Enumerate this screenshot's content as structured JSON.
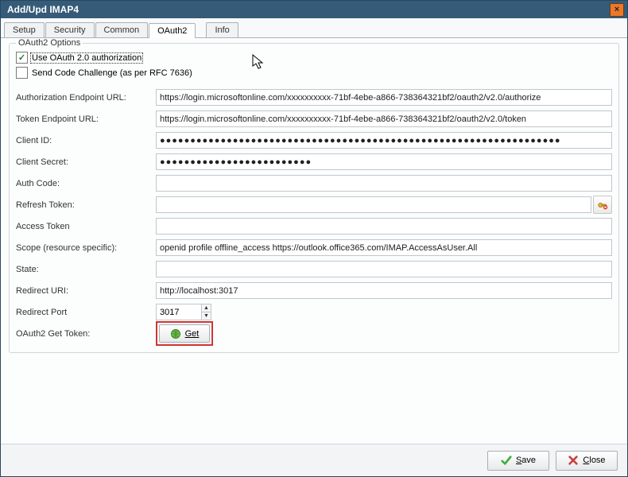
{
  "window": {
    "title": "Add/Upd IMAP4"
  },
  "tabs": [
    "Setup",
    "Security",
    "Common",
    "OAuth2",
    "Info"
  ],
  "active_tab_index": 3,
  "fieldset_legend": "OAuth2 Options",
  "checkboxes": {
    "use_oauth": {
      "label": "Use OAuth 2.0 authorization",
      "checked": true
    },
    "code_challenge": {
      "label": "Send Code Challenge (as per RFC 7636)",
      "checked": false
    }
  },
  "labels": {
    "auth_endpoint": "Authorization Endpoint URL:",
    "token_endpoint": "Token Endpoint URL:",
    "client_id": "Client ID:",
    "client_secret": "Client Secret:",
    "auth_code": "Auth Code:",
    "refresh_token": "Refresh Token:",
    "access_token": "Access Token",
    "scope": "Scope (resource specific):",
    "state": "State:",
    "redirect_uri": "Redirect URI:",
    "redirect_port": "Redirect Port",
    "get_token": "OAuth2 Get Token:"
  },
  "values": {
    "auth_endpoint": "https://login.microsoftonline.com/xxxxxxxxxx-71bf-4ebe-a866-738364321bf2/oauth2/v2.0/authorize",
    "token_endpoint": "https://login.microsoftonline.com/xxxxxxxxxx-71bf-4ebe-a866-738364321bf2/oauth2/v2.0/token",
    "client_id_mask": "●●●●●●●●●●●●●●●●●●●●●●●●●●●●●●●●●●●●●●●●●●●●●●●●●●●●●●●●●●●●●●●●●●",
    "client_secret_mask": "●●●●●●●●●●●●●●●●●●●●●●●●●",
    "auth_code": "",
    "refresh_token": "",
    "access_token": "",
    "scope": "openid profile offline_access https://outlook.office365.com/IMAP.AccessAsUser.All",
    "state": "",
    "redirect_uri": "http://localhost:3017",
    "redirect_port": "3017"
  },
  "buttons": {
    "get": "Get",
    "save": "Save",
    "close": "Close"
  }
}
